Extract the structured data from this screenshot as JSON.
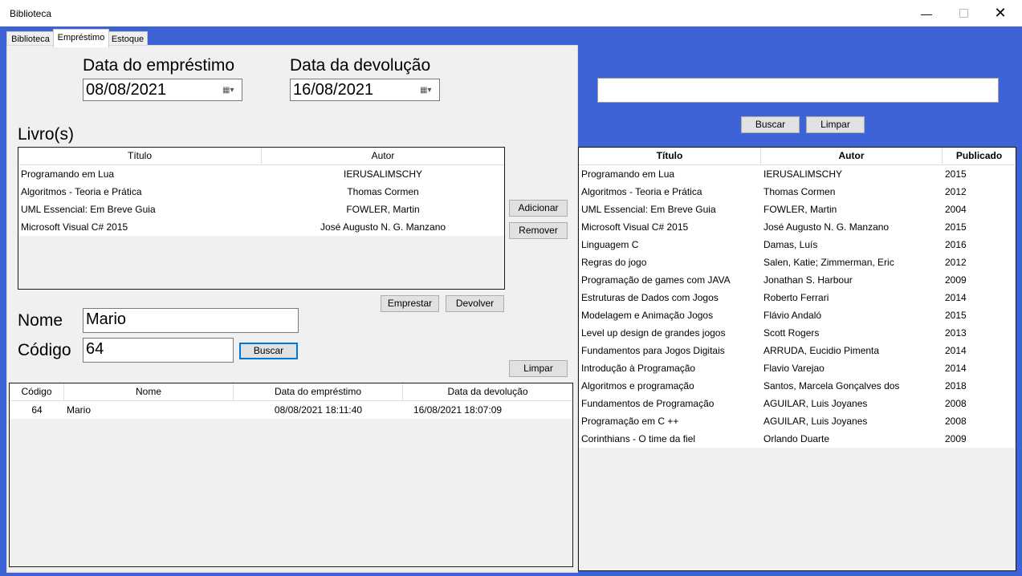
{
  "window": {
    "title": "Biblioteca"
  },
  "tabs": [
    {
      "label": "Biblioteca"
    },
    {
      "label": "Empréstimo"
    },
    {
      "label": "Estoque"
    }
  ],
  "loan": {
    "loan_date_label": "Data do empréstimo",
    "loan_date_value": "08/08/2021",
    "return_date_label": "Data da devolução",
    "return_date_value": "16/08/2021",
    "books_label": "Livro(s)",
    "books_columns": [
      "Título",
      "Autor"
    ],
    "books": [
      {
        "title": "Programando em Lua",
        "author": "IERUSALIMSCHY"
      },
      {
        "title": "Algoritmos - Teoria e Prática",
        "author": "Thomas Cormen"
      },
      {
        "title": "UML Essencial: Em Breve Guia",
        "author": "FOWLER, Martin"
      },
      {
        "title": "Microsoft Visual C# 2015",
        "author": "José Augusto N. G. Manzano"
      }
    ],
    "add_button": "Adicionar",
    "remove_button": "Remover",
    "lend_button": "Emprestar",
    "return_button": "Devolver",
    "name_label": "Nome",
    "name_value": "Mario",
    "code_label": "Código",
    "code_value": "64",
    "search_button": "Buscar",
    "clear_button": "Limpar",
    "loans_columns": [
      "Código",
      "Nome",
      "Data do empréstimo",
      "Data da devolução"
    ],
    "loans": [
      {
        "code": "64",
        "name": "Mario",
        "loan_date": "08/08/2021 18:11:40",
        "return_date": "16/08/2021 18:07:09"
      }
    ]
  },
  "catalog": {
    "search_value": "",
    "search_button": "Buscar",
    "clear_button": "Limpar",
    "columns": [
      "Título",
      "Autor",
      "Publicado"
    ],
    "books": [
      {
        "title": "Programando em Lua",
        "author": "IERUSALIMSCHY",
        "year": "2015"
      },
      {
        "title": "Algoritmos - Teoria e Prática",
        "author": "Thomas Cormen",
        "year": "2012"
      },
      {
        "title": "UML Essencial: Em Breve Guia",
        "author": "FOWLER, Martin",
        "year": "2004"
      },
      {
        "title": "Microsoft Visual C# 2015",
        "author": "José Augusto N. G. Manzano",
        "year": "2015"
      },
      {
        "title": "Linguagem C",
        "author": "Damas, Luís",
        "year": "2016"
      },
      {
        "title": "Regras do jogo",
        "author": "Salen, Katie; Zimmerman, Eric",
        "year": "2012"
      },
      {
        "title": "Programação de games com JAVA",
        "author": "Jonathan S. Harbour",
        "year": "2009"
      },
      {
        "title": "Estruturas de Dados com Jogos",
        "author": "Roberto Ferrari",
        "year": "2014"
      },
      {
        "title": "Modelagem e Animação Jogos",
        "author": "Flávio Andaló",
        "year": "2015"
      },
      {
        "title": "Level up design de grandes jogos",
        "author": "Scott Rogers",
        "year": "2013"
      },
      {
        "title": "Fundamentos para Jogos Digitais",
        "author": "ARRUDA, Eucidio Pimenta",
        "year": "2014"
      },
      {
        "title": "Introdução à Programação",
        "author": "Flavio Varejao",
        "year": "2014"
      },
      {
        "title": "Algoritmos e programação",
        "author": "Santos, Marcela Gonçalves dos",
        "year": "2018"
      },
      {
        "title": "Fundamentos de Programação",
        "author": "AGUILAR, Luis Joyanes",
        "year": "2008"
      },
      {
        "title": "Programação em C ++",
        "author": "AGUILAR, Luis Joyanes",
        "year": "2008"
      },
      {
        "title": "Corinthians - O time da fiel",
        "author": "Orlando Duarte",
        "year": "2009"
      }
    ]
  },
  "icons": {
    "minimize": "minimize-icon",
    "maximize": "maximize-icon",
    "close": "close-icon",
    "calendar": "calendar-dropdown-icon"
  },
  "colors": {
    "accent": "#3e63d7"
  }
}
